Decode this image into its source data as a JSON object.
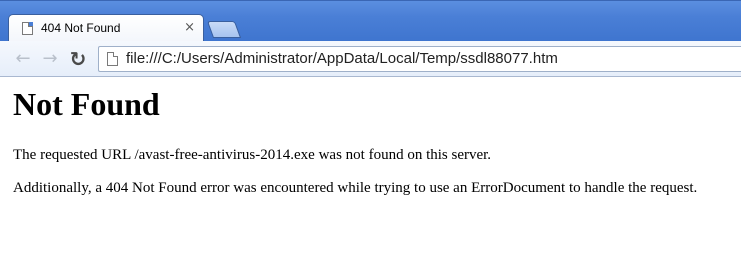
{
  "tab": {
    "title": "404 Not Found",
    "close_glyph": "×"
  },
  "toolbar": {
    "back_glyph": "←",
    "forward_glyph": "→",
    "reload_glyph": "↻",
    "url": "file:///C:/Users/Administrator/AppData/Local/Temp/ssdl88077.htm"
  },
  "page": {
    "heading": "Not Found",
    "paragraph1": "The requested URL /avast-free-antivirus-2014.exe was not found on this server.",
    "paragraph2": "Additionally, a 404 Not Found error was encountered while trying to use an ErrorDocument to handle the request."
  },
  "icons": {
    "tab_icon": "page-icon",
    "omnibox_icon": "page-icon",
    "back": "arrow-left-icon",
    "forward": "arrow-right-icon",
    "reload": "reload-icon",
    "close": "close-icon"
  },
  "colors": {
    "chrome_blue": "#4a7fd6",
    "toolbar_bg": "#e6eefa"
  }
}
